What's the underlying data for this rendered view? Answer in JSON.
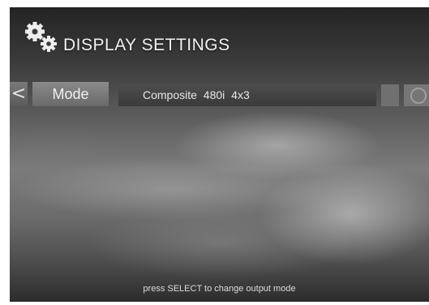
{
  "header": {
    "title": "DISPLAY SETTINGS",
    "icon": "gears-icon"
  },
  "setting": {
    "nav_left": "<",
    "label": "Mode",
    "value": "Composite 480i 4x3"
  },
  "footer": {
    "hint": "press SELECT to change output mode"
  }
}
